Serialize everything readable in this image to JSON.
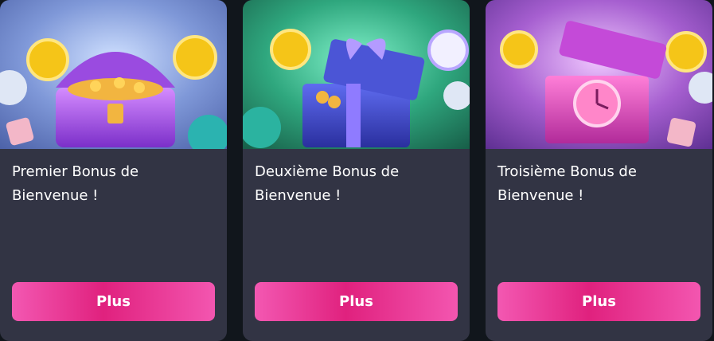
{
  "cards": [
    {
      "title": "Premier Bonus de\nBienvenue !",
      "button": "Plus",
      "image": "treasure-chest-icon",
      "bg_top": "#5c77c8",
      "bg_bottom": "#a9bde6"
    },
    {
      "title": "Deuxième Bonus de\nBienvenue !",
      "button": "Plus",
      "image": "gift-box-icon",
      "bg_top": "#1f7a5e",
      "bg_bottom": "#3fc39a"
    },
    {
      "title": "Troisième Bonus de\nBienvenue !",
      "button": "Plus",
      "image": "clock-gift-box-icon",
      "bg_top": "#6a3fa3",
      "bg_bottom": "#c68be0"
    }
  ]
}
